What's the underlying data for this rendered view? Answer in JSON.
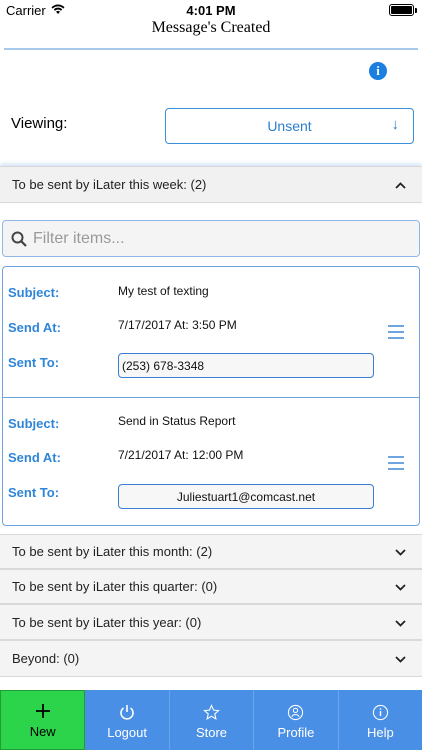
{
  "status_bar": {
    "carrier": "Carrier",
    "time": "4:01 PM"
  },
  "header": {
    "title": "Message's Created"
  },
  "viewing": {
    "label": "Viewing:",
    "selected": "Unsent",
    "arrow": "↓"
  },
  "sections": {
    "week": {
      "label": "To be sent by iLater this week: (2)",
      "chevron": "⌃"
    },
    "month": {
      "label": "To be sent by iLater this month: (2)",
      "chevron": "⌄"
    },
    "quarter": {
      "label": "To be sent by iLater this quarter: (0)",
      "chevron": "⌄"
    },
    "year": {
      "label": "To be sent by iLater this year: (0)",
      "chevron": "⌄"
    },
    "beyond": {
      "label": "Beyond: (0)",
      "chevron": "⌄"
    }
  },
  "filter": {
    "placeholder": "Filter items..."
  },
  "labels": {
    "subject": "Subject:",
    "send_at": "Send At:",
    "sent_to": "Sent To:"
  },
  "messages": [
    {
      "subject": "My test of texting",
      "send_at": "7/17/2017 At: 3:50 PM",
      "sent_to": "(253) 678-3348"
    },
    {
      "subject": "Send in Status Report",
      "send_at": "7/21/2017 At: 12:00 PM",
      "sent_to": "Juliestuart1@comcast.net"
    }
  ],
  "tabs": [
    {
      "label": "New",
      "icon": "plus-icon"
    },
    {
      "label": "Logout",
      "icon": "power-icon"
    },
    {
      "label": "Store",
      "icon": "star-icon"
    },
    {
      "label": "Profile",
      "icon": "profile-icon"
    },
    {
      "label": "Help",
      "icon": "info-icon"
    }
  ],
  "colors": {
    "accent": "#2f86d8",
    "tab_bar": "#4a8fe6",
    "new_tab": "#2bd44a"
  }
}
